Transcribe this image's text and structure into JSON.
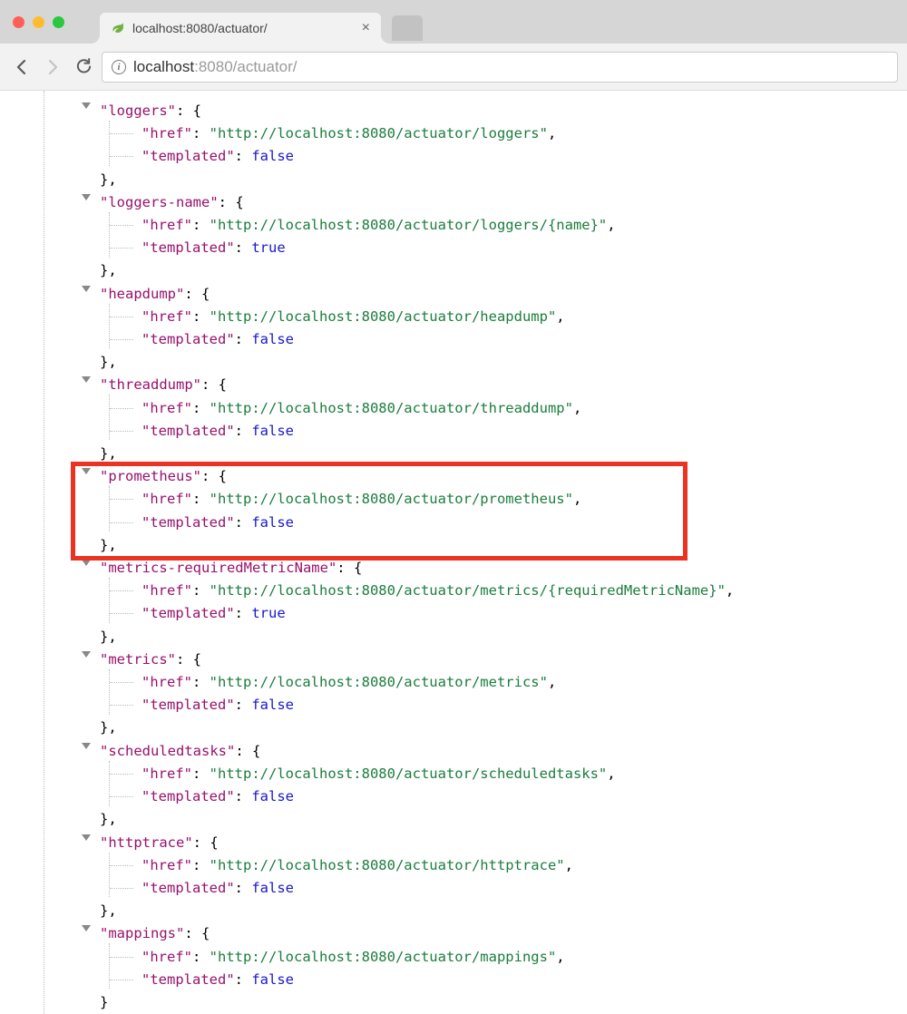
{
  "window": {
    "tab_title": "localhost:8080/actuator/",
    "address_host": "localhost",
    "address_path": ":8080/actuator/"
  },
  "json_labels": {
    "href": "href",
    "templated": "templated",
    "true": "true",
    "false": "false"
  },
  "entries": [
    {
      "key": "loggers",
      "href": "http://localhost:8080/actuator/loggers",
      "templated": false,
      "highlight": false
    },
    {
      "key": "loggers-name",
      "href": "http://localhost:8080/actuator/loggers/{name}",
      "templated": true,
      "highlight": false
    },
    {
      "key": "heapdump",
      "href": "http://localhost:8080/actuator/heapdump",
      "templated": false,
      "highlight": false
    },
    {
      "key": "threaddump",
      "href": "http://localhost:8080/actuator/threaddump",
      "templated": false,
      "highlight": false
    },
    {
      "key": "prometheus",
      "href": "http://localhost:8080/actuator/prometheus",
      "templated": false,
      "highlight": true
    },
    {
      "key": "metrics-requiredMetricName",
      "href": "http://localhost:8080/actuator/metrics/{requiredMetricName}",
      "templated": true,
      "highlight": false
    },
    {
      "key": "metrics",
      "href": "http://localhost:8080/actuator/metrics",
      "templated": false,
      "highlight": false
    },
    {
      "key": "scheduledtasks",
      "href": "http://localhost:8080/actuator/scheduledtasks",
      "templated": false,
      "highlight": false
    },
    {
      "key": "httptrace",
      "href": "http://localhost:8080/actuator/httptrace",
      "templated": false,
      "highlight": false
    },
    {
      "key": "mappings",
      "href": "http://localhost:8080/actuator/mappings",
      "templated": false,
      "highlight": false
    }
  ]
}
